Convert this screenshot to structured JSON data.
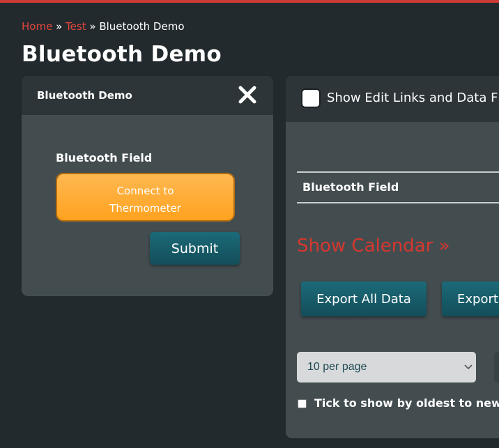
{
  "breadcrumb": {
    "home": "Home",
    "sep1": "»",
    "test": "Test",
    "sep2": "»",
    "current": "Bluetooth Demo"
  },
  "page": {
    "title": "Bluetooth Demo"
  },
  "form_panel": {
    "title": "Bluetooth Demo",
    "close_icon": "close-icon",
    "field_label": "Bluetooth Field",
    "connect_line1": "Connect to",
    "connect_line2": "Thermometer",
    "submit_label": "Submit"
  },
  "data_panel": {
    "edit_links_label": "Show Edit Links and Data F",
    "edit_links_checked": false,
    "column_header": "Bluetooth Field",
    "calendar_link": "Show Calendar »",
    "export_all_label": "Export All Data",
    "export_label": "Export",
    "per_page_value": "10 per page",
    "oldest_label": "Tick to show by oldest to newe",
    "oldest_checked": false
  },
  "colors": {
    "background": "#232a2d",
    "panel": "#434d50",
    "panel_header": "#2e3538",
    "accent_red": "#d6372f",
    "button_teal": "#1a6270",
    "button_orange": "#ffab35"
  }
}
